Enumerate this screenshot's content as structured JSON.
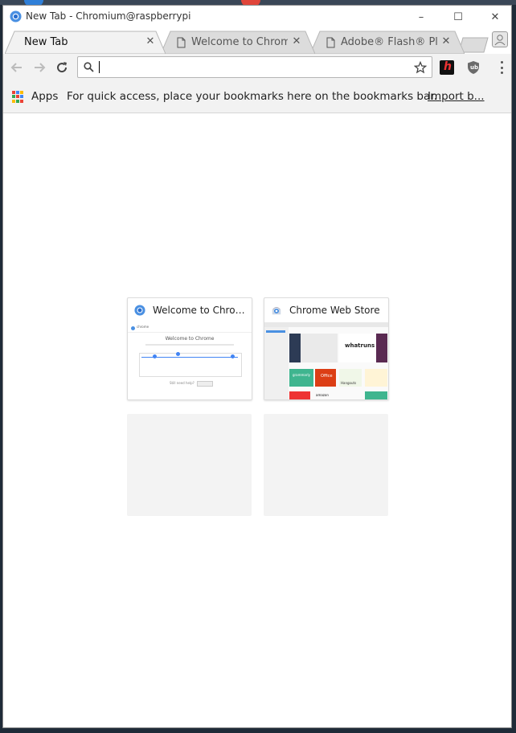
{
  "window": {
    "title": "New Tab - Chromium@raspberrypi",
    "controls": {
      "minimize": "–",
      "maximize": "☐",
      "close": "✕"
    }
  },
  "tabs": [
    {
      "label": "New Tab",
      "active": true
    },
    {
      "label": "Welcome to Chrom",
      "active": false
    },
    {
      "label": "Adobe® Flash® Pl",
      "active": false
    }
  ],
  "tab_close_glyph": "✕",
  "omnibox": {
    "value": "",
    "placeholder": ""
  },
  "extensions": [
    {
      "name": "honey-extension",
      "glyph": "h",
      "color": "#111111"
    },
    {
      "name": "ublock-extension",
      "glyph": "ub",
      "color": "#6b6b6b"
    }
  ],
  "bookmarks_bar": {
    "apps_label": "Apps",
    "hint": "For quick access, place your bookmarks here on the bookmarks bar.",
    "import_link": "Import b..."
  },
  "most_visited": [
    {
      "title": "Welcome to Chromi…",
      "thumb": {
        "header": "chrome",
        "heading": "Welcome to Chrome",
        "footer": "Still need help?"
      }
    },
    {
      "title": "Chrome Web Store",
      "thumb": {
        "brand": "whatruns",
        "office": "Office",
        "hangouts": "Hangouts",
        "grammarly": "grammarly",
        "amazon": "amazon"
      }
    }
  ],
  "colors": {
    "accent": "#4285f4",
    "toolbar": "#f2f2f2",
    "apps_dots": [
      "#ea4335",
      "#4285f4",
      "#fbbc05",
      "#34a853",
      "#ea4335",
      "#4285f4",
      "#fbbc05",
      "#34a853",
      "#ea4335"
    ]
  }
}
